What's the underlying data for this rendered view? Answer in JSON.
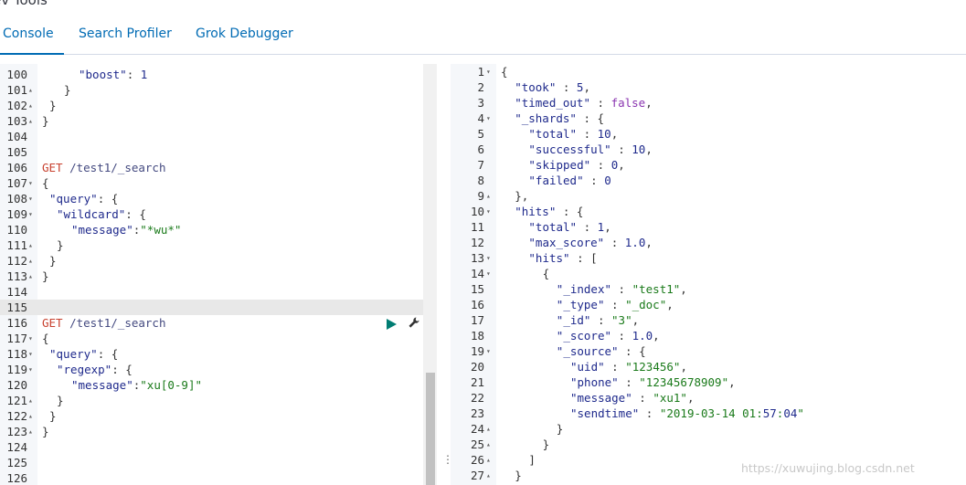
{
  "app": {
    "title": "ev Tools"
  },
  "tabs": [
    {
      "label": "Console"
    },
    {
      "label": "Search Profiler"
    },
    {
      "label": "Grok Debugger"
    }
  ],
  "request_editor": {
    "lines": [
      {
        "n": "100",
        "fold": "",
        "text": "\"boost\": 1",
        "kind": "kv"
      },
      {
        "n": "101",
        "fold": "▴",
        "text": "}",
        "kind": "p"
      },
      {
        "n": "102",
        "fold": "▴",
        "text": "}",
        "kind": "p"
      },
      {
        "n": "103",
        "fold": "▴",
        "text": "}",
        "kind": "p"
      },
      {
        "n": "104",
        "fold": "",
        "text": "",
        "kind": "p"
      },
      {
        "n": "105",
        "fold": "",
        "text": "",
        "kind": "p"
      },
      {
        "n": "106",
        "fold": "",
        "text": "GET /test1/_search",
        "kind": "req"
      },
      {
        "n": "107",
        "fold": "▾",
        "text": "{",
        "kind": "p"
      },
      {
        "n": "108",
        "fold": "▾",
        "text": "\"query\": {",
        "kind": "kv"
      },
      {
        "n": "109",
        "fold": "▾",
        "text": "\"wildcard\": {",
        "kind": "kv"
      },
      {
        "n": "110",
        "fold": "",
        "text": "\"message\":\"*wu*\"",
        "kind": "kv"
      },
      {
        "n": "111",
        "fold": "▴",
        "text": "}",
        "kind": "p"
      },
      {
        "n": "112",
        "fold": "▴",
        "text": "}",
        "kind": "p"
      },
      {
        "n": "113",
        "fold": "▴",
        "text": "}",
        "kind": "p"
      },
      {
        "n": "114",
        "fold": "",
        "text": "",
        "kind": "p"
      },
      {
        "n": "115",
        "fold": "",
        "text": "",
        "kind": "p"
      },
      {
        "n": "116",
        "fold": "",
        "text": "GET /test1/_search",
        "kind": "req"
      },
      {
        "n": "117",
        "fold": "▾",
        "text": "{",
        "kind": "p"
      },
      {
        "n": "118",
        "fold": "▾",
        "text": "\"query\": {",
        "kind": "kv"
      },
      {
        "n": "119",
        "fold": "▾",
        "text": "\"regexp\": {",
        "kind": "kv"
      },
      {
        "n": "120",
        "fold": "",
        "text": "\"message\":\"xu[0-9]\"",
        "kind": "kv"
      },
      {
        "n": "121",
        "fold": "▴",
        "text": "}",
        "kind": "p"
      },
      {
        "n": "122",
        "fold": "▴",
        "text": "}",
        "kind": "p"
      },
      {
        "n": "123",
        "fold": "▴",
        "text": "}",
        "kind": "p"
      },
      {
        "n": "124",
        "fold": "",
        "text": "",
        "kind": "p"
      },
      {
        "n": "125",
        "fold": "",
        "text": "",
        "kind": "p"
      },
      {
        "n": "126",
        "fold": "",
        "text": "",
        "kind": "p"
      }
    ]
  },
  "response_viewer": {
    "lines": [
      {
        "n": "1",
        "fold": "▾",
        "text": "{"
      },
      {
        "n": "2",
        "fold": "",
        "text": "\"took\" : 5,"
      },
      {
        "n": "3",
        "fold": "",
        "text": "\"timed_out\" : false,"
      },
      {
        "n": "4",
        "fold": "▾",
        "text": "\"_shards\" : {"
      },
      {
        "n": "5",
        "fold": "",
        "text": "\"total\" : 10,"
      },
      {
        "n": "6",
        "fold": "",
        "text": "\"successful\" : 10,"
      },
      {
        "n": "7",
        "fold": "",
        "text": "\"skipped\" : 0,"
      },
      {
        "n": "8",
        "fold": "",
        "text": "\"failed\" : 0"
      },
      {
        "n": "9",
        "fold": "▴",
        "text": "},"
      },
      {
        "n": "10",
        "fold": "▾",
        "text": "\"hits\" : {"
      },
      {
        "n": "11",
        "fold": "",
        "text": "\"total\" : 1,"
      },
      {
        "n": "12",
        "fold": "",
        "text": "\"max_score\" : 1.0,"
      },
      {
        "n": "13",
        "fold": "▾",
        "text": "\"hits\" : ["
      },
      {
        "n": "14",
        "fold": "▾",
        "text": "{"
      },
      {
        "n": "15",
        "fold": "",
        "text": "\"_index\" : \"test1\","
      },
      {
        "n": "16",
        "fold": "",
        "text": "\"_type\" : \"_doc\","
      },
      {
        "n": "17",
        "fold": "",
        "text": "\"_id\" : \"3\","
      },
      {
        "n": "18",
        "fold": "",
        "text": "\"_score\" : 1.0,"
      },
      {
        "n": "19",
        "fold": "▾",
        "text": "\"_source\" : {"
      },
      {
        "n": "20",
        "fold": "",
        "text": "\"uid\" : \"123456\","
      },
      {
        "n": "21",
        "fold": "",
        "text": "\"phone\" : \"12345678909\","
      },
      {
        "n": "22",
        "fold": "",
        "text": "\"message\" : \"xu1\","
      },
      {
        "n": "23",
        "fold": "",
        "text": "\"sendtime\" : \"2019-03-14 01:57:04\""
      },
      {
        "n": "24",
        "fold": "▴",
        "text": "}"
      },
      {
        "n": "25",
        "fold": "▴",
        "text": "}"
      },
      {
        "n": "26",
        "fold": "▴",
        "text": "]"
      },
      {
        "n": "27",
        "fold": "▴",
        "text": "}"
      }
    ]
  },
  "actions": {
    "run_icon": "play-icon",
    "settings_icon": "wrench-icon"
  },
  "watermark": "https://xuwujing.blog.csdn.net",
  "colors": {
    "accent": "#006bb4",
    "play": "#017d73",
    "method": "#c8412f",
    "string": "#1a7a1a",
    "key": "#1f2a8c"
  }
}
